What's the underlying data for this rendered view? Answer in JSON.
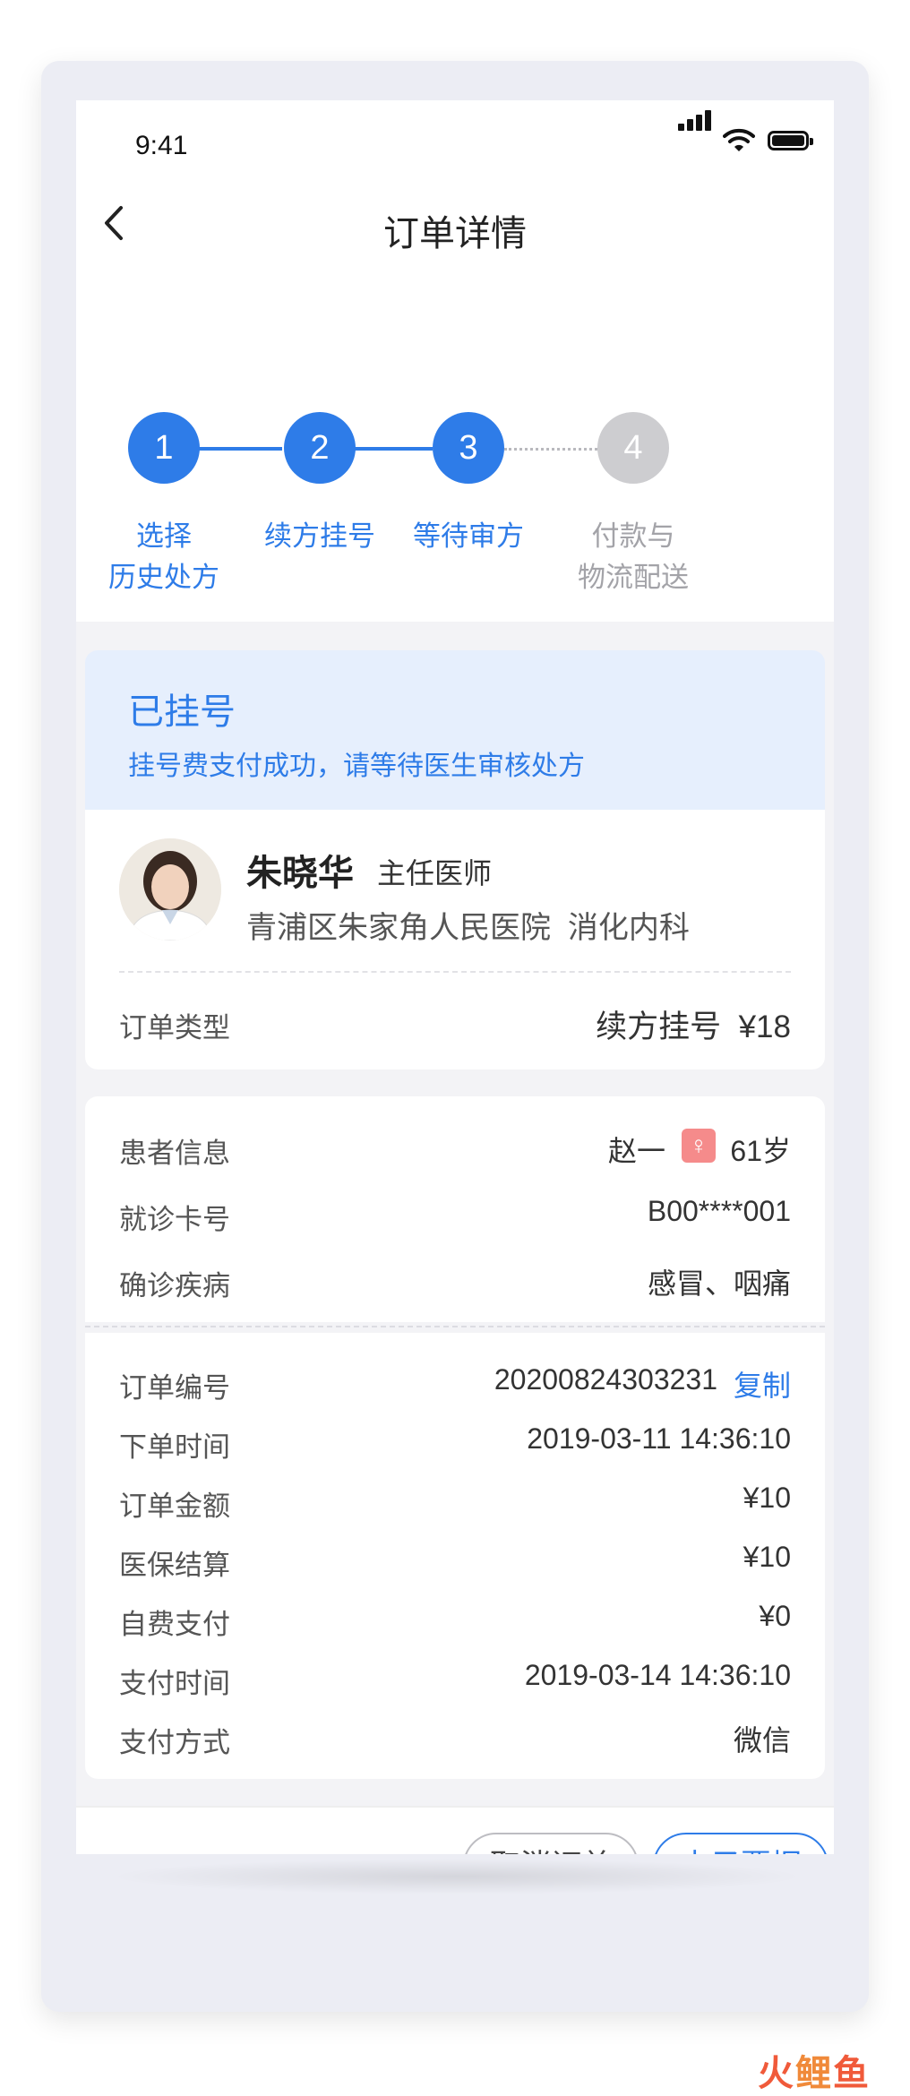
{
  "status_bar": {
    "time": "9:41"
  },
  "nav": {
    "title": "订单详情"
  },
  "steps": [
    {
      "number": "1",
      "label_line1": "选择",
      "label_line2": "历史处方",
      "active": true
    },
    {
      "number": "2",
      "label_line1": "续方挂号",
      "label_line2": "",
      "active": true
    },
    {
      "number": "3",
      "label_line1": "等待审方",
      "label_line2": "",
      "active": true
    },
    {
      "number": "4",
      "label_line1": "付款与",
      "label_line2": "物流配送",
      "active": false
    }
  ],
  "banner": {
    "title": "已挂号",
    "subtitle": "挂号费支付成功，请等待医生审核处方"
  },
  "doctor": {
    "name": "朱晓华",
    "title": "主任医师",
    "hospital": "青浦区朱家角人民医院  消化内科",
    "order_type_label": "订单类型",
    "order_type_value": "续方挂号  ¥18"
  },
  "patient": {
    "info_label": "患者信息",
    "name": "赵一",
    "gender_symbol": "♀",
    "age": "61岁",
    "card_label": "就诊卡号",
    "card_value": "B00****001",
    "diagnosis_label": "确诊疾病",
    "diagnosis_value": "感冒、咽痛"
  },
  "order": {
    "number_label": "订单编号",
    "number_value": "20200824303231",
    "copy_label": "复制",
    "rows": [
      {
        "label": "下单时间",
        "value": "2019-03-11 14:36:10"
      },
      {
        "label": "订单金额",
        "value": "¥10"
      },
      {
        "label": "医保结算",
        "value": "¥10"
      },
      {
        "label": "自费支付",
        "value": "¥0"
      },
      {
        "label": "支付时间",
        "value": "2019-03-14 14:36:10"
      },
      {
        "label": "支付方式",
        "value": "微信"
      }
    ]
  },
  "actions": {
    "cancel_label": "取消订单",
    "invoice_label": "电子票据"
  },
  "watermark": {
    "char1": "火",
    "char2": "鲤",
    "char3": "鱼"
  },
  "colors": {
    "accent": "#2e7ce8",
    "inactive": "#cdcdd0",
    "banner_bg": "#e6effd",
    "female_badge": "#f58b8b"
  }
}
